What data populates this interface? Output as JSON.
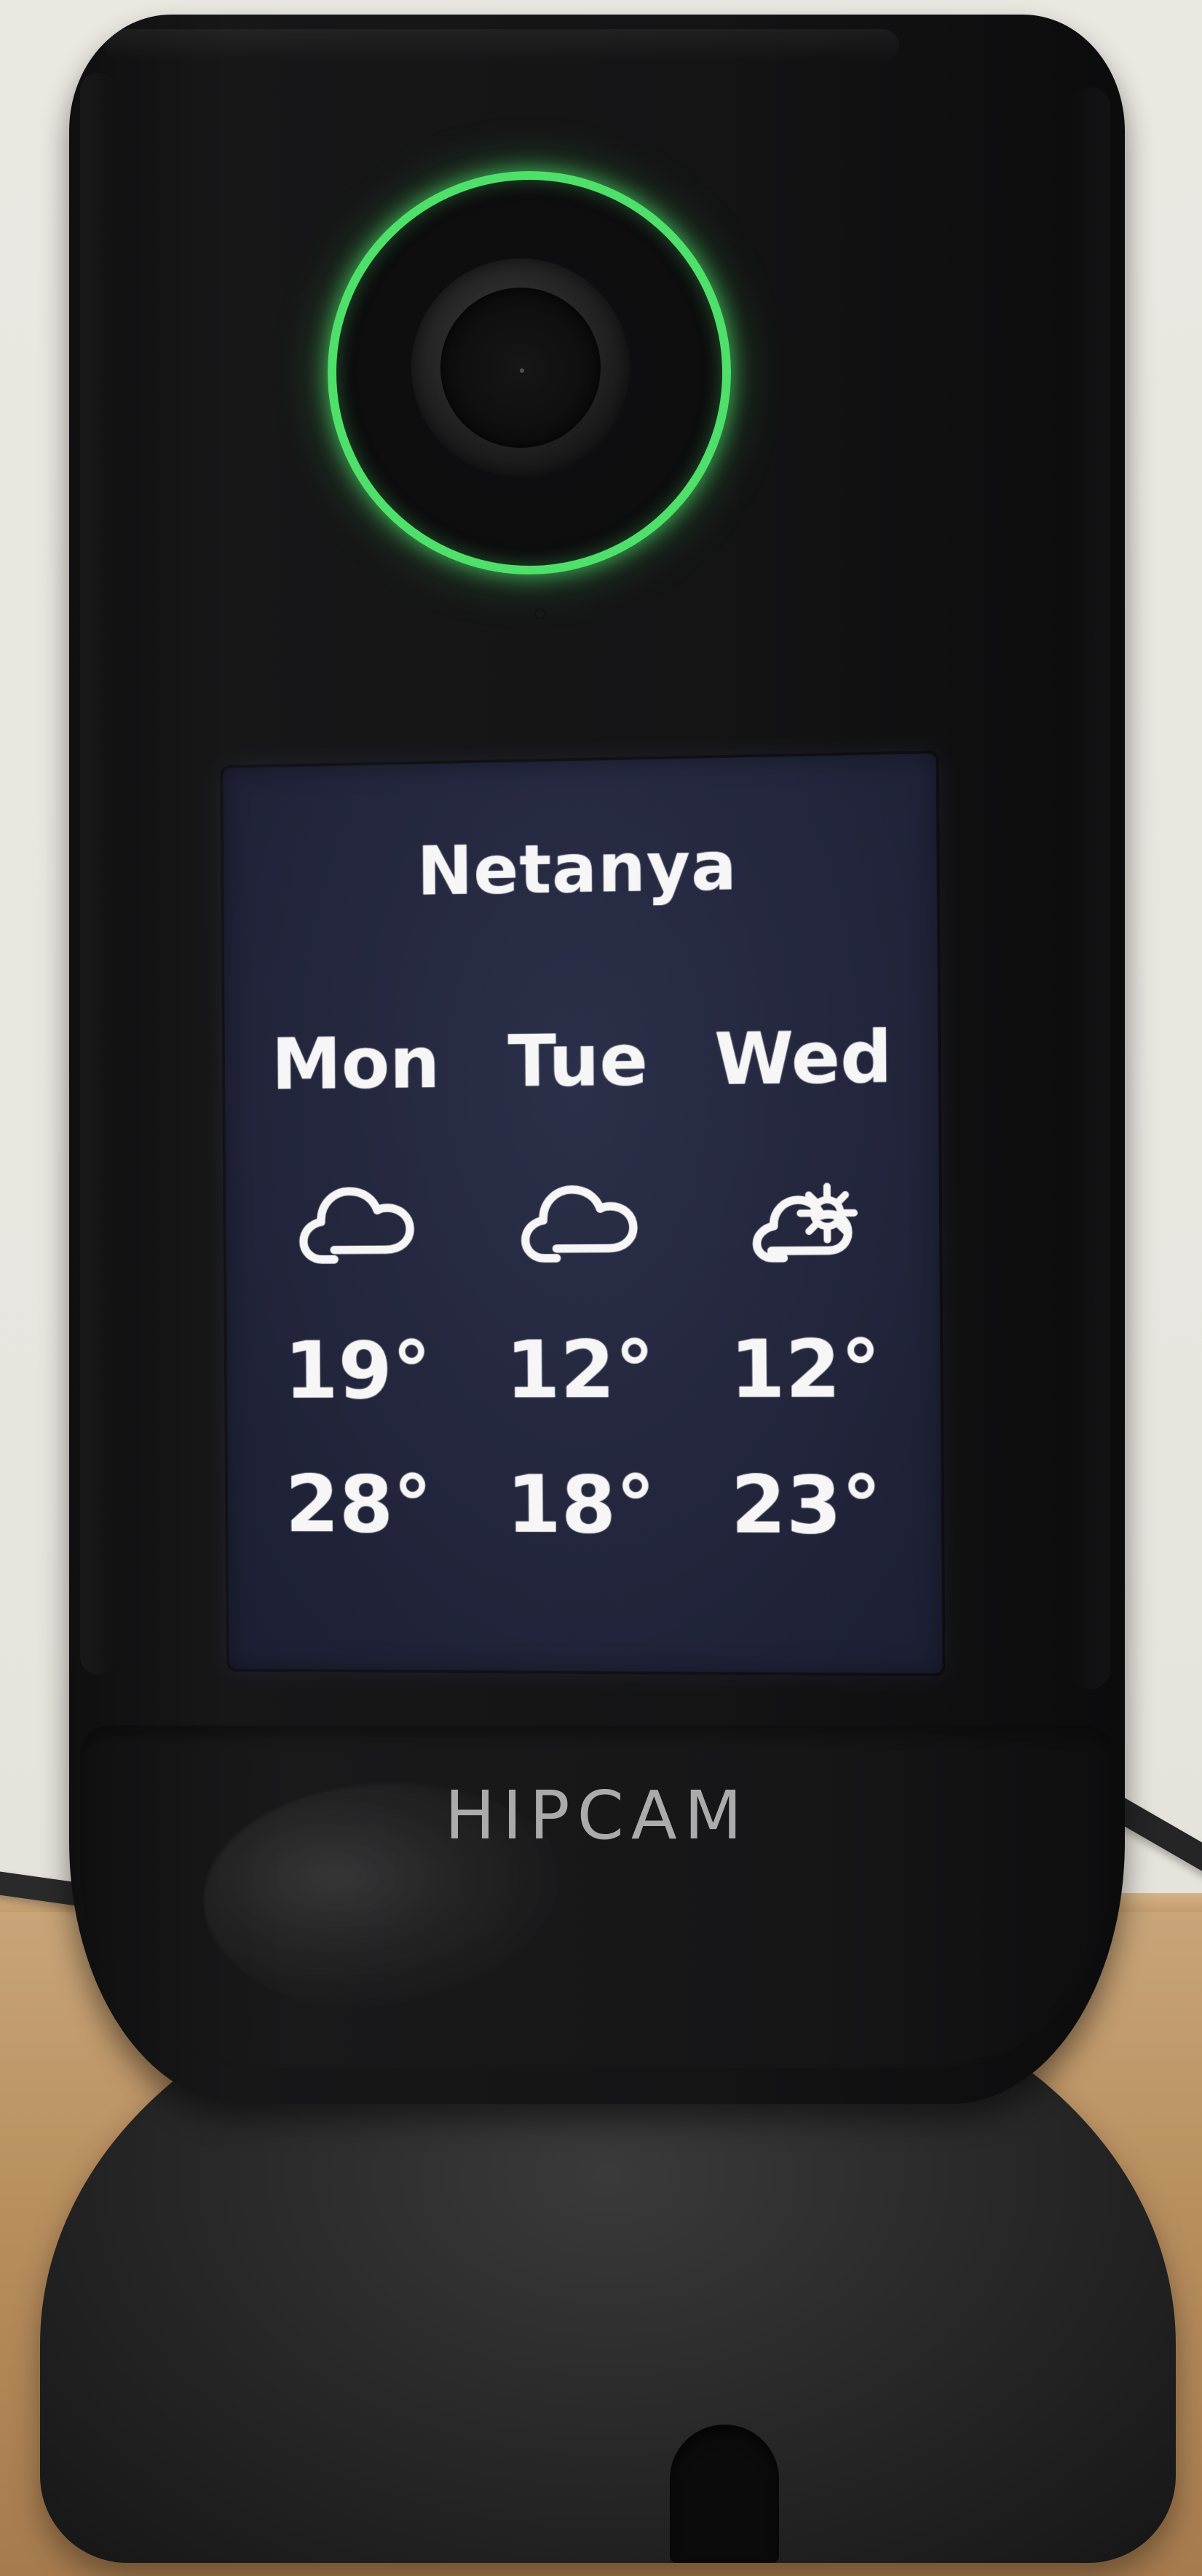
{
  "screen": {
    "city": "Netanya",
    "days": [
      {
        "label": "Mon",
        "icon": "cloud-icon",
        "low": "19°",
        "high": "28°"
      },
      {
        "label": "Tue",
        "icon": "cloud-icon",
        "low": "12°",
        "high": "18°"
      },
      {
        "label": "Wed",
        "icon": "partly-sunny-icon",
        "low": "12°",
        "high": "23°"
      }
    ],
    "colors": {
      "ring_green": "#4ee06a",
      "screen_bg": "#22253b",
      "text": "#f6f6f6"
    }
  },
  "device": {
    "brand": "HIPCAM"
  }
}
